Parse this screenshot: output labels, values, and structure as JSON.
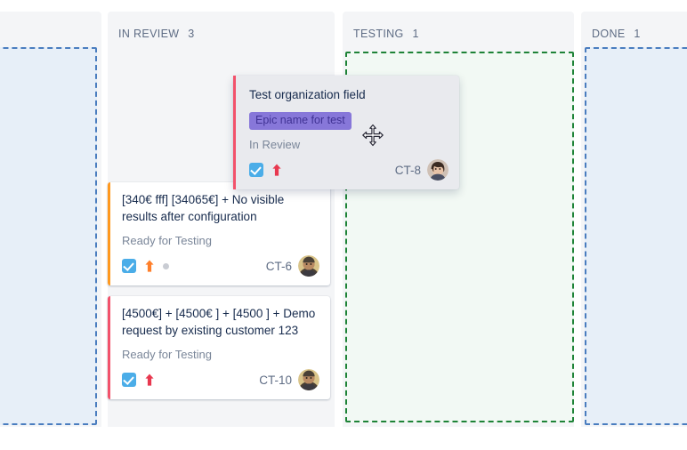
{
  "board": {
    "columns": [
      {
        "id": "backlog",
        "title": "",
        "count": "",
        "dropzone_color": "#4a7dbf",
        "dropzone_bg": "#e7eff8"
      },
      {
        "id": "inreview",
        "title": "IN REVIEW",
        "count": "3",
        "dropzone_color": "",
        "dropzone_bg": ""
      },
      {
        "id": "testing",
        "title": "TESTING",
        "count": "1",
        "dropzone_color": "#1e8337",
        "dropzone_bg": "#f2f9f4"
      },
      {
        "id": "done",
        "title": "DONE",
        "count": "1",
        "dropzone_color": "#4a7dbf",
        "dropzone_bg": "#e7eff8"
      }
    ]
  },
  "dragged_card": {
    "title": "Test organization field",
    "epic": "Epic name for test",
    "status": "In Review",
    "key": "CT-8",
    "bar_color": "#f2526b",
    "epic_color": "#8777d9",
    "priority_color": "#e8384f",
    "check_color": "#4bade8",
    "cursor": "move-cursor"
  },
  "cards": [
    {
      "title": "[340€ fff] [34065€] + No visible results after configuration",
      "status": "Ready for Testing",
      "key": "CT-6",
      "bar_color": "#ff991f",
      "priority_color": "#ff7f2a",
      "check_color": "#4bade8",
      "has_dot": true
    },
    {
      "title": "[4500€] + [4500€ ] + [4500 ] + Demo request by existing customer 123",
      "status": "Ready for Testing",
      "key": "CT-10",
      "bar_color": "#f2526b",
      "priority_color": "#e8384f",
      "check_color": "#4bade8",
      "has_dot": false
    }
  ]
}
